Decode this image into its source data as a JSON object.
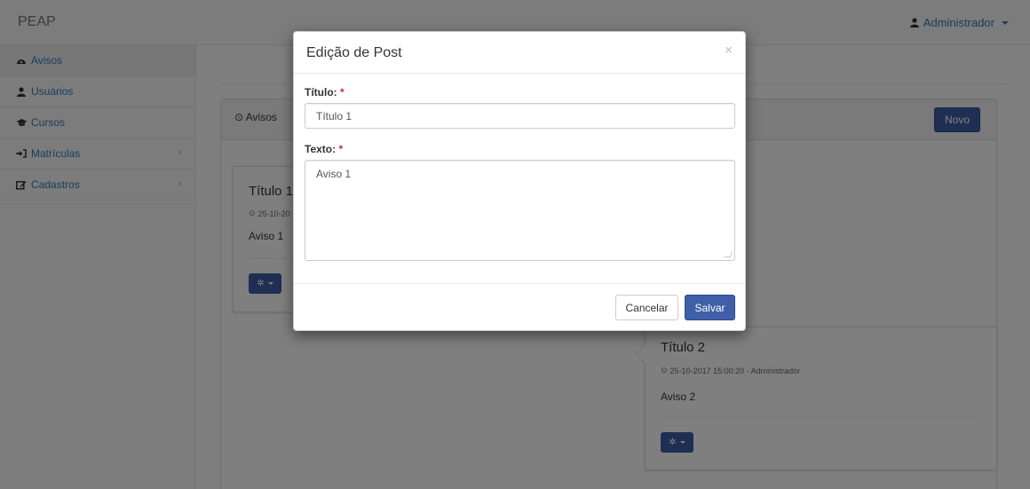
{
  "app": {
    "brand": "PEAP"
  },
  "user_menu": {
    "label": "Administrador"
  },
  "sidebar": {
    "items": [
      {
        "label": "Avisos",
        "icon": "dashboard-icon"
      },
      {
        "label": "Usuários",
        "icon": "user-icon"
      },
      {
        "label": "Cursos",
        "icon": "graduation-cap-icon"
      },
      {
        "label": "Matrículas",
        "icon": "sign-in-icon",
        "has_children": true
      },
      {
        "label": "Cadastros",
        "icon": "edit-icon",
        "has_children": true
      }
    ]
  },
  "panel": {
    "title": "Avisos",
    "new_button": "Novo"
  },
  "posts": [
    {
      "title": "Título 1",
      "meta": "25-10-20",
      "body": "Aviso 1"
    },
    {
      "title": "Título 2",
      "meta": "25-10-2017 15:00:20 - Administrador",
      "body": "Aviso 2"
    }
  ],
  "modal": {
    "title": "Edição de Post",
    "close": "×",
    "title_label": "Título:",
    "title_value": "Título 1",
    "text_label": "Texto:",
    "text_value": "Aviso 1",
    "required_mark": "*",
    "cancel_label": "Cancelar",
    "save_label": "Salvar"
  },
  "colors": {
    "primary": "#3f5fa8",
    "link": "#337ab7",
    "required": "#c9302c"
  }
}
